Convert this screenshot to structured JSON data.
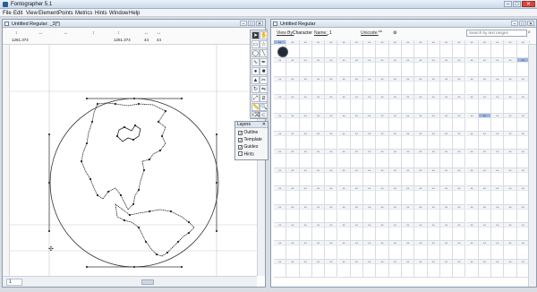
{
  "app": {
    "title": "Fontographer 5.1"
  },
  "menu": [
    "File",
    "Edit",
    "View",
    "Element",
    "Points",
    "Metrics",
    "Hints",
    "Window",
    "Help"
  ],
  "glyph_window": {
    "title": "Untitled Regular: _3[*]",
    "metrics": [
      {
        "icon": "↕",
        "value": "1261.374"
      },
      {
        "icon": "↔",
        "value": ""
      },
      {
        "icon": "↔",
        "value": ""
      },
      {
        "icon": "↕",
        "value": ""
      },
      {
        "icon": "↕",
        "value": "1261.374"
      },
      {
        "icon": "↔",
        "value": "44"
      },
      {
        "icon": "↔",
        "value": "44"
      }
    ],
    "zoom": "1"
  },
  "layers": {
    "title": "Layers",
    "items": [
      {
        "label": "Outline",
        "checked": true
      },
      {
        "label": "Template",
        "checked": true
      },
      {
        "label": "Guides",
        "checked": true
      },
      {
        "label": "Hints",
        "checked": false
      }
    ]
  },
  "font_window": {
    "title": "Untitled Regular",
    "view_by_label": "View By:",
    "view_by_value": "Character",
    "name_label": "Name:",
    "name_value": "_1",
    "unicode_label": "Unicode:",
    "unicode_value": "**",
    "search_placeholder": "Search by text ranges",
    "cell_header": "**"
  }
}
